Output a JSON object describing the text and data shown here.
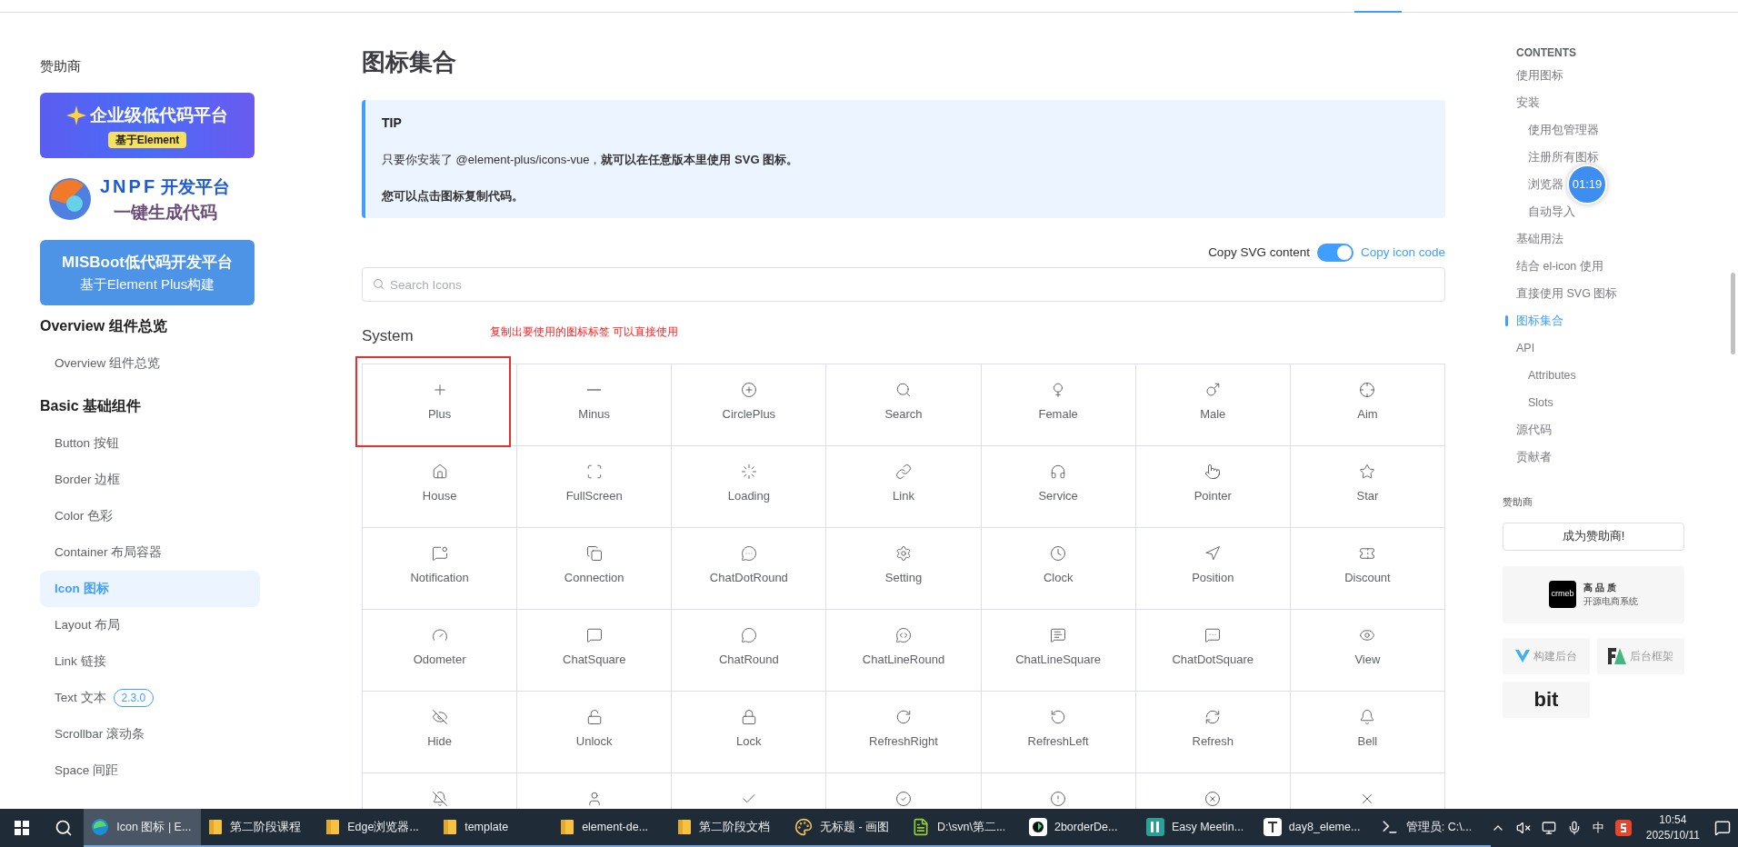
{
  "sidebar": {
    "sponsor_heading": "赞助商",
    "banners": [
      {
        "kind": "lowcode",
        "title": "企业级低代码平台",
        "pill": "基于Element"
      },
      {
        "kind": "jnpf",
        "brand": "JNPF",
        "title": "开发平台",
        "subtitle": "一键生成代码"
      },
      {
        "kind": "misboot",
        "title": "MISBoot低代码开发平台",
        "subtitle": "基于Element Plus构建"
      }
    ],
    "groups": [
      {
        "heading": "Overview 组件总览",
        "items": [
          {
            "label": "Overview 组件总览",
            "selected": false
          }
        ]
      },
      {
        "heading": "Basic 基础组件",
        "items": [
          {
            "label": "Button 按钮",
            "selected": false
          },
          {
            "label": "Border 边框",
            "selected": false
          },
          {
            "label": "Color 色彩",
            "selected": false
          },
          {
            "label": "Container 布局容器",
            "selected": false
          },
          {
            "label": "Icon 图标",
            "selected": true
          },
          {
            "label": "Layout 布局",
            "selected": false
          },
          {
            "label": "Link 链接",
            "selected": false
          },
          {
            "label": "Text 文本",
            "selected": false,
            "badge": "2.3.0"
          },
          {
            "label": "Scrollbar 滚动条",
            "selected": false
          },
          {
            "label": "Space 间距",
            "selected": false
          }
        ]
      }
    ]
  },
  "main": {
    "title": "图标集合",
    "tip": {
      "title": "TIP",
      "lines": [
        "只要你安装了 @element-plus/icons-vue，**就可以在任意版本里使用 SVG 图标。**",
        "**您可以点击图标复制代码。**"
      ]
    },
    "copy_toggle": {
      "label": "Copy SVG content",
      "on": true,
      "alt_label": "Copy icon code"
    },
    "search": {
      "placeholder": "Search Icons"
    },
    "section": "System",
    "annotation": "复制出要使用的图标标签 可以直接使用",
    "icons": [
      {
        "label": "Plus",
        "marked": true
      },
      {
        "label": "Minus",
        "marked": false
      },
      {
        "label": "CirclePlus",
        "marked": false
      },
      {
        "label": "Search",
        "marked": false
      },
      {
        "label": "Female",
        "marked": false
      },
      {
        "label": "Male",
        "marked": false
      },
      {
        "label": "Aim",
        "marked": false
      },
      {
        "label": "House",
        "marked": false
      },
      {
        "label": "FullScreen",
        "marked": false
      },
      {
        "label": "Loading",
        "marked": false
      },
      {
        "label": "Link",
        "marked": false
      },
      {
        "label": "Service",
        "marked": false
      },
      {
        "label": "Pointer",
        "marked": false
      },
      {
        "label": "Star",
        "marked": false
      },
      {
        "label": "Notification",
        "marked": false
      },
      {
        "label": "Connection",
        "marked": false
      },
      {
        "label": "ChatDotRound",
        "marked": false
      },
      {
        "label": "Setting",
        "marked": false
      },
      {
        "label": "Clock",
        "marked": false
      },
      {
        "label": "Position",
        "marked": false
      },
      {
        "label": "Discount",
        "marked": false
      },
      {
        "label": "Odometer",
        "marked": false
      },
      {
        "label": "ChatSquare",
        "marked": false
      },
      {
        "label": "ChatRound",
        "marked": false
      },
      {
        "label": "ChatLineRound",
        "marked": false
      },
      {
        "label": "ChatLineSquare",
        "marked": false
      },
      {
        "label": "ChatDotSquare",
        "marked": false
      },
      {
        "label": "View",
        "marked": false
      },
      {
        "label": "Hide",
        "marked": false
      },
      {
        "label": "Unlock",
        "marked": false
      },
      {
        "label": "Lock",
        "marked": false
      },
      {
        "label": "RefreshRight",
        "marked": false
      },
      {
        "label": "RefreshLeft",
        "marked": false
      },
      {
        "label": "Refresh",
        "marked": false
      },
      {
        "label": "Bell",
        "marked": false
      },
      {
        "marked": false
      },
      {
        "marked": false
      },
      {
        "marked": false
      },
      {
        "marked": false
      },
      {
        "marked": false
      },
      {
        "marked": false
      },
      {
        "marked": false
      }
    ]
  },
  "toc": {
    "heading": "CONTENTS",
    "items": [
      {
        "label": "使用图标",
        "selected": false
      },
      {
        "label": "安装",
        "selected": false,
        "children": [
          {
            "label": "使用包管理器",
            "selected": false
          },
          {
            "label": "注册所有图标",
            "selected": false
          },
          {
            "label": "浏览器",
            "selected": false
          },
          {
            "label": "自动导入",
            "selected": false
          }
        ]
      },
      {
        "label": "基础用法",
        "selected": false
      },
      {
        "label": "结合 el-icon 使用",
        "selected": false
      },
      {
        "label": "直接使用 SVG 图标",
        "selected": false
      },
      {
        "label": "图标集合",
        "selected": true
      },
      {
        "label": "API",
        "selected": false,
        "children": [
          {
            "label": "Attributes",
            "selected": false
          },
          {
            "label": "Slots",
            "selected": false
          }
        ]
      },
      {
        "label": "源代码",
        "selected": false
      },
      {
        "label": "贡献者",
        "selected": false
      }
    ],
    "sponsor_heading": "赞助商",
    "sponsor_button": "成为赞助商!",
    "crmeb": {
      "logo": "crmeb",
      "slogan": "高 品 质",
      "subtitle": "开源电商系统"
    },
    "small_sponsors": [
      {
        "kind": "vue",
        "label": "构建后台"
      },
      {
        "kind": "fa",
        "label": "后台框架"
      },
      {
        "kind": "bit",
        "label": "bit"
      }
    ]
  },
  "timer": "01:19",
  "taskbar": {
    "apps": [
      {
        "kind": "browser",
        "label": "Icon 图标 | E...",
        "selected": true
      },
      {
        "kind": "folder",
        "label": "第二阶段课程",
        "selected": false
      },
      {
        "kind": "folder",
        "label": "Edge浏览器...",
        "selected": false
      },
      {
        "kind": "folder",
        "label": "template",
        "selected": false
      },
      {
        "kind": "folder",
        "label": "element-de...",
        "selected": false
      },
      {
        "kind": "folder",
        "label": "第二阶段文档",
        "selected": false
      },
      {
        "kind": "paint",
        "label": "无标题 - 画图",
        "selected": false
      },
      {
        "kind": "notepad",
        "label": "D:\\svn\\第二...",
        "selected": false
      },
      {
        "kind": "dark",
        "label": "2borderDe...",
        "selected": false
      },
      {
        "kind": "meeting",
        "label": "Easy Meetin...",
        "selected": false
      },
      {
        "kind": "typora",
        "label": "day8_eleme...",
        "selected": false
      },
      {
        "kind": "terminal",
        "label": "管理员: C:\\...",
        "selected": false
      }
    ],
    "ime": "中",
    "time": "10:54",
    "date": "2025/10/11"
  }
}
